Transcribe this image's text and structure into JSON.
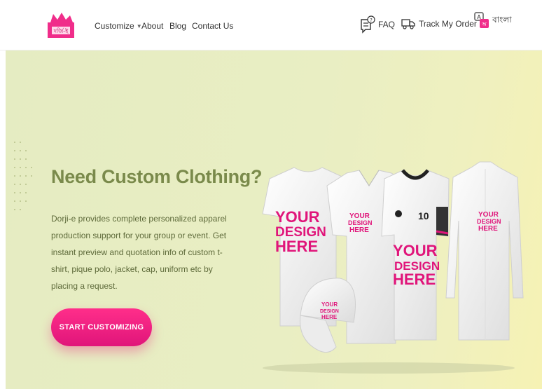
{
  "header": {
    "logo_text": "দর্জি-ই",
    "nav": [
      {
        "label": "Customize"
      },
      {
        "label": "About"
      },
      {
        "label": "Blog"
      },
      {
        "label": "Contact Us"
      }
    ],
    "right": {
      "faq_label": "FAQ",
      "track_label": "Track My Order",
      "lang_label": "বাংলা"
    }
  },
  "hero": {
    "title": "Need Custom Clothing?",
    "description": "Dorji-e provides complete personalized apparel production support for your group or event. Get instant preview and quotation info of custom t-shirt, pique polo, jacket, cap, uniform etc by placing a request.",
    "cta_label": "START CUSTOMIZING",
    "product_text": [
      "YOUR",
      "DESIGN",
      "HERE"
    ],
    "jersey_number": "10"
  },
  "colors": {
    "accent": "#e0157a",
    "headline": "#7a8a4b",
    "hero_bg": "#e6ecc2"
  }
}
